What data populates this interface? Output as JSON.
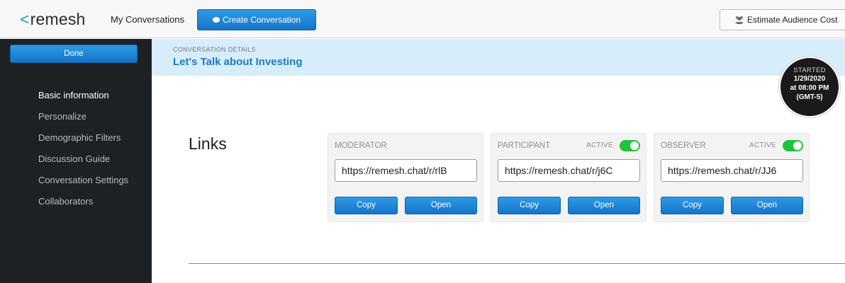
{
  "app": {
    "logo_text": "remesh",
    "logo_chevron": "<",
    "brand_color": "#2aa39a"
  },
  "topbar": {
    "my_conversations": "My Conversations",
    "create_conversation": "Create Conversation",
    "create_icon": "chat-bubbles-icon",
    "estimate_audience_cost": "Estimate Audience Cost",
    "estimate_icon": "people-icon"
  },
  "sidebar": {
    "done_label": "Done",
    "items": [
      {
        "label": "Basic information",
        "active": true
      },
      {
        "label": "Personalize",
        "active": false
      },
      {
        "label": "Demographic Filters",
        "active": false
      },
      {
        "label": "Discussion Guide",
        "active": false
      },
      {
        "label": "Conversation Settings",
        "active": false
      },
      {
        "label": "Collaborators",
        "active": false
      }
    ]
  },
  "details": {
    "label": "CONVERSATION DETAILS",
    "title": "Let's Talk about Investing"
  },
  "started": {
    "label": "STARTED",
    "date": "1/29/2020",
    "time": "at 08:00 PM",
    "tz": "(GMT-5)"
  },
  "links": {
    "heading": "Links",
    "cards": [
      {
        "title": "MODERATOR",
        "url": "https://remesh.chat/r/rlB",
        "has_toggle": false,
        "copy_label": "Copy",
        "open_label": "Open"
      },
      {
        "title": "PARTICIPANT",
        "url": "https://remesh.chat/r/j6C",
        "has_toggle": true,
        "active_label": "ACTIVE",
        "active": true,
        "copy_label": "Copy",
        "open_label": "Open"
      },
      {
        "title": "OBSERVER",
        "url": "https://remesh.chat/r/JJ6",
        "has_toggle": true,
        "active_label": "ACTIVE",
        "active": true,
        "copy_label": "Copy",
        "open_label": "Open"
      }
    ]
  },
  "colors": {
    "primary_button": "#1a86d6",
    "sidebar_bg": "#1e2124",
    "details_band": "#d7eefa",
    "title_blue": "#1a7bbf",
    "toggle_on": "#1fc43a"
  }
}
